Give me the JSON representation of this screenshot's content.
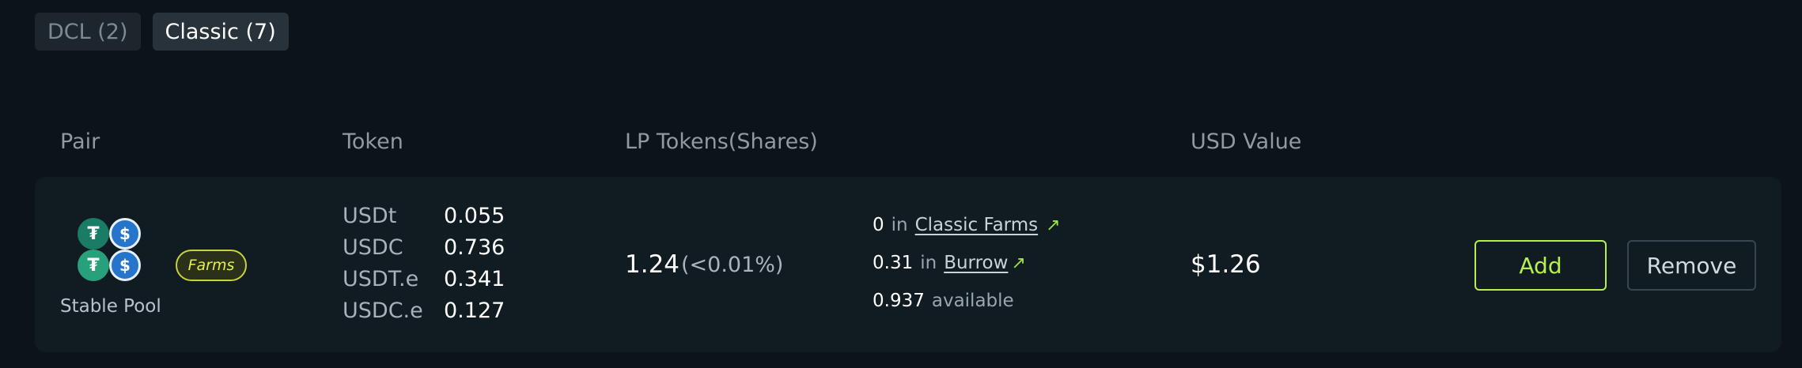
{
  "tabs": [
    {
      "label": "DCL (2)",
      "active": false
    },
    {
      "label": "Classic (7)",
      "active": true
    }
  ],
  "table": {
    "headers": {
      "pair": "Pair",
      "token": "Token",
      "lp_tokens": "LP Tokens(Shares)",
      "usd_value": "USD Value"
    }
  },
  "row": {
    "pool_name": "Stable Pool",
    "badge": "Farms",
    "pair_icons": [
      "tether-icon",
      "usdc-icon",
      "tether-icon",
      "usdc-icon"
    ],
    "tokens": [
      {
        "symbol": "USDt",
        "amount": "0.055"
      },
      {
        "symbol": "USDC",
        "amount": "0.736"
      },
      {
        "symbol": "USDT.e",
        "amount": "0.341"
      },
      {
        "symbol": "USDC.e",
        "amount": "0.127"
      }
    ],
    "lp_amount": "1.24",
    "lp_percent": "(<0.01%)",
    "locations": {
      "classic_farms_amount": "0",
      "classic_farms_in": "in",
      "classic_farms_link": "Classic Farms",
      "burrow_amount": "0.31",
      "burrow_in": "in",
      "burrow_link": "Burrow",
      "available_amount": "0.937",
      "available_label": "available"
    },
    "usd_value": "$1.26",
    "add_label": "Add",
    "remove_label": "Remove"
  },
  "colors": {
    "accent": "#b6f04d",
    "badge": "#e5ef4d",
    "background": "#0c1419",
    "card": "#101c22",
    "tether": "#26a17b",
    "usdc": "#2775ca"
  }
}
